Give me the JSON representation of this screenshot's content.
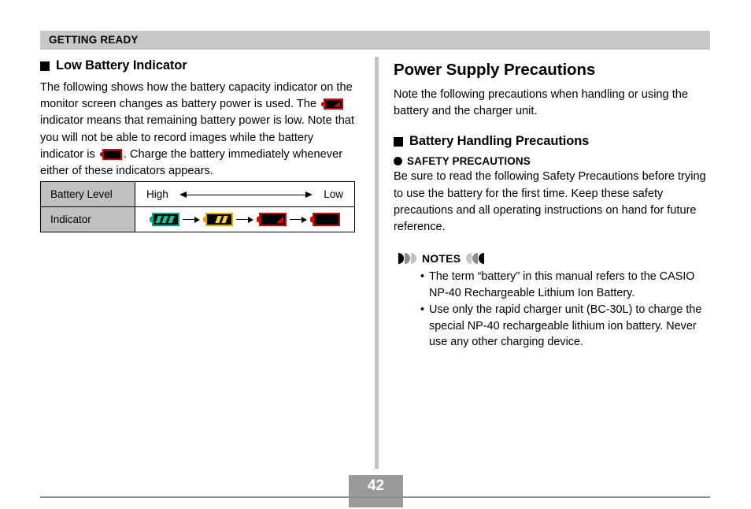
{
  "header": {
    "title": "GETTING READY"
  },
  "left_column": {
    "section_heading": "Low Battery Indicator",
    "paragraph_part1": "The following shows how the battery capacity indicator on the monitor screen changes as battery power is used. The",
    "paragraph_part2": "indicator means that remaining battery power is low. Note that you will not be able to record images while the battery indicator is",
    "paragraph_part3": ". Charge the battery immediately whenever either of these indicators appears.",
    "table": {
      "rows": [
        {
          "label": "Battery Level",
          "left_value": "High",
          "right_value": "Low"
        },
        {
          "label": "Indicator"
        }
      ],
      "indicators": [
        {
          "name": "battery-full-green-icon",
          "state": "full",
          "color": "#00a884"
        },
        {
          "name": "battery-medium-yellow-icon",
          "state": "medium",
          "color": "#e8a800"
        },
        {
          "name": "battery-low-red-icon",
          "state": "low",
          "color": "#e00000"
        },
        {
          "name": "battery-empty-red-icon",
          "state": "empty",
          "color": "#e00000"
        }
      ],
      "arrow_separator": "→"
    }
  },
  "right_column": {
    "section_heading": "Power Supply Precautions",
    "intro_paragraph": "Note the following precautions when handling or using the battery and the charger unit.",
    "subsection_heading": "Battery Handling Precautions",
    "safety_heading": "SAFETY PRECAUTIONS",
    "safety_paragraph": "Be sure to read the following Safety Precautions before trying to use the battery for the first time. Keep these safety precautions and all operating instructions on hand for future reference.",
    "notes_title": "NOTES",
    "notes_items": [
      "The term “battery” in this manual refers to the CASIO NP-40 Rechargeable Lithium Ion Battery.",
      "Use only the rapid charger unit (BC-30L) to charge the special NP-40 rechargeable lithium ion battery. Never use any other charging device."
    ]
  },
  "footer": {
    "page_number": "42"
  },
  "colors": {
    "header_band": "#c8c8c8",
    "table_label_cell": "#c0c0c0",
    "divider": "#c2c2c2",
    "page_block": "#9a9a9a",
    "footer_rule": "#8e8e8e"
  }
}
